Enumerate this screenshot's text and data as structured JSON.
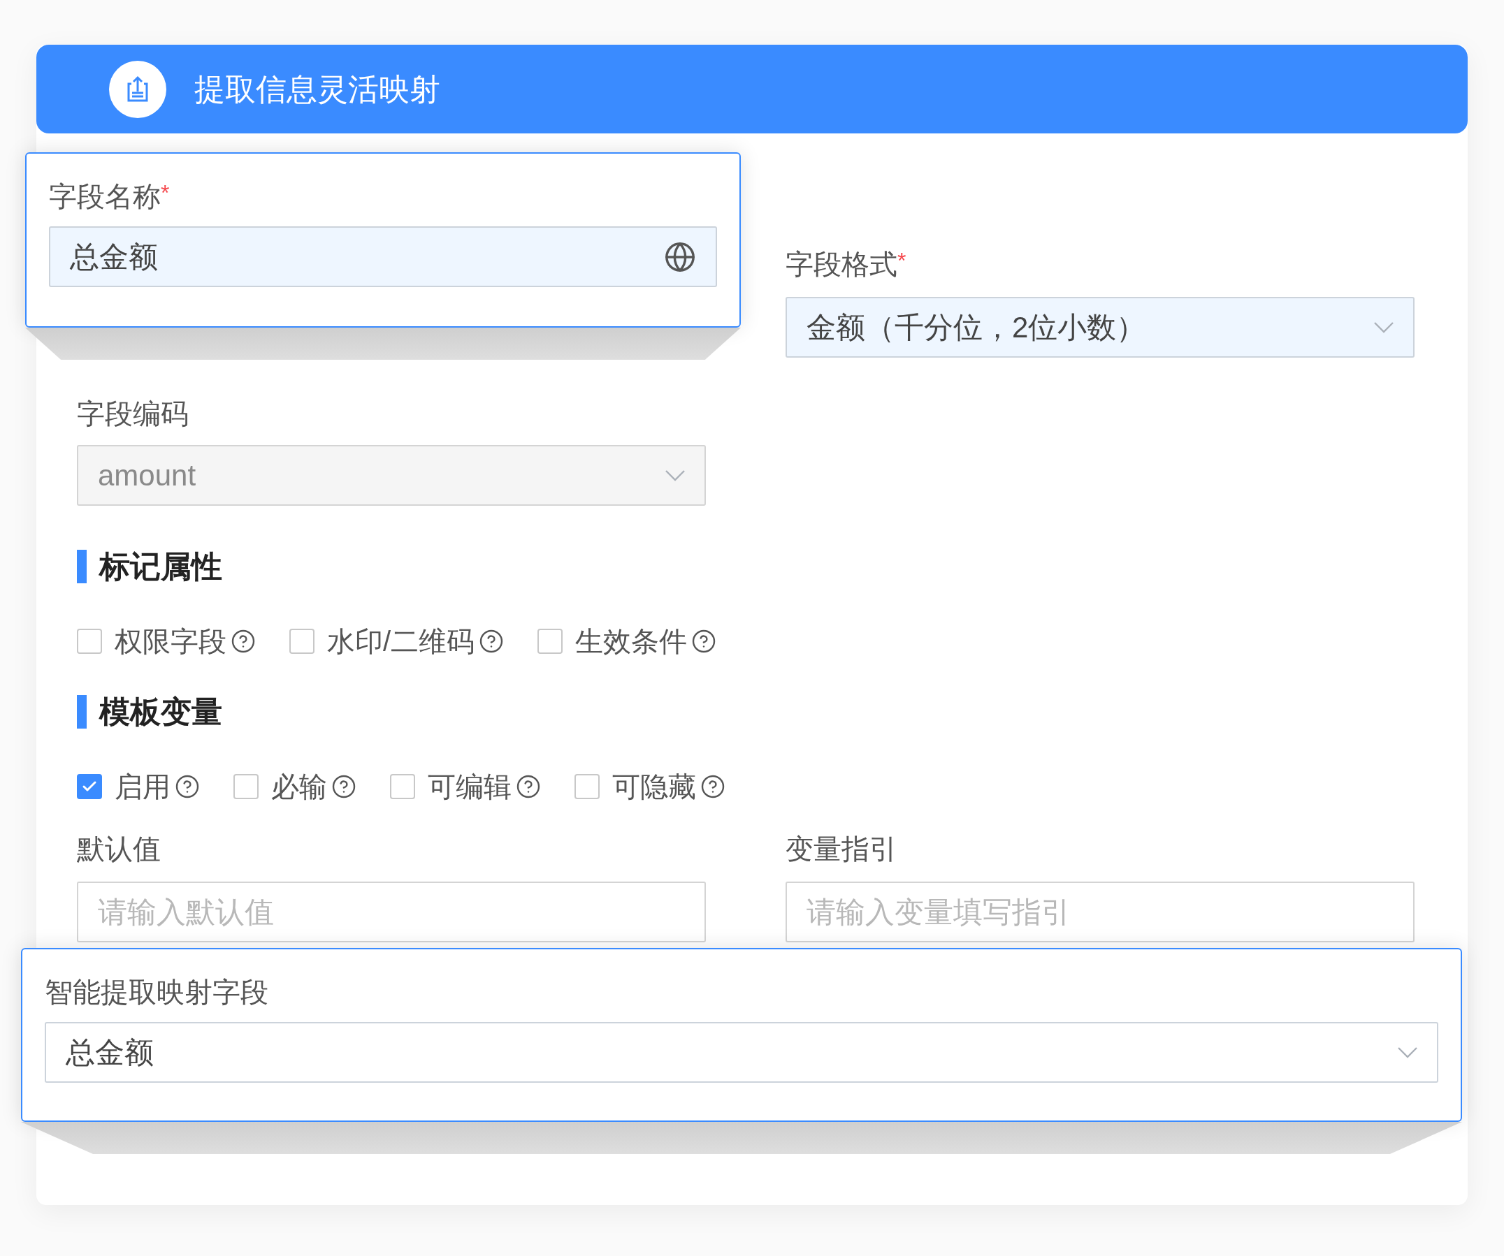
{
  "header": {
    "title": "提取信息灵活映射"
  },
  "name_popup": {
    "label": "字段名称",
    "required_mark": "*",
    "value": "总金额"
  },
  "format_field": {
    "label": "字段格式",
    "required_mark": "*",
    "value": "金额（千分位，2位小数）"
  },
  "code_field": {
    "label": "字段编码",
    "value": "amount",
    "disabled": true
  },
  "sections": [
    {
      "title": "标记属性",
      "options": [
        {
          "label": "权限字段",
          "checked": false
        },
        {
          "label": "水印/二维码",
          "checked": false
        },
        {
          "label": "生效条件",
          "checked": false
        }
      ]
    },
    {
      "title": "模板变量",
      "options": [
        {
          "label": "启用",
          "checked": true
        },
        {
          "label": "必输",
          "checked": false
        },
        {
          "label": "可编辑",
          "checked": false
        },
        {
          "label": "可隐藏",
          "checked": false
        }
      ]
    }
  ],
  "text_fields": [
    {
      "label": "默认值",
      "placeholder": "请输入默认值"
    },
    {
      "label": "变量指引",
      "placeholder": "请输入变量填写指引"
    }
  ],
  "mapping_popup": {
    "label": "智能提取映射字段",
    "value": "总金额"
  }
}
